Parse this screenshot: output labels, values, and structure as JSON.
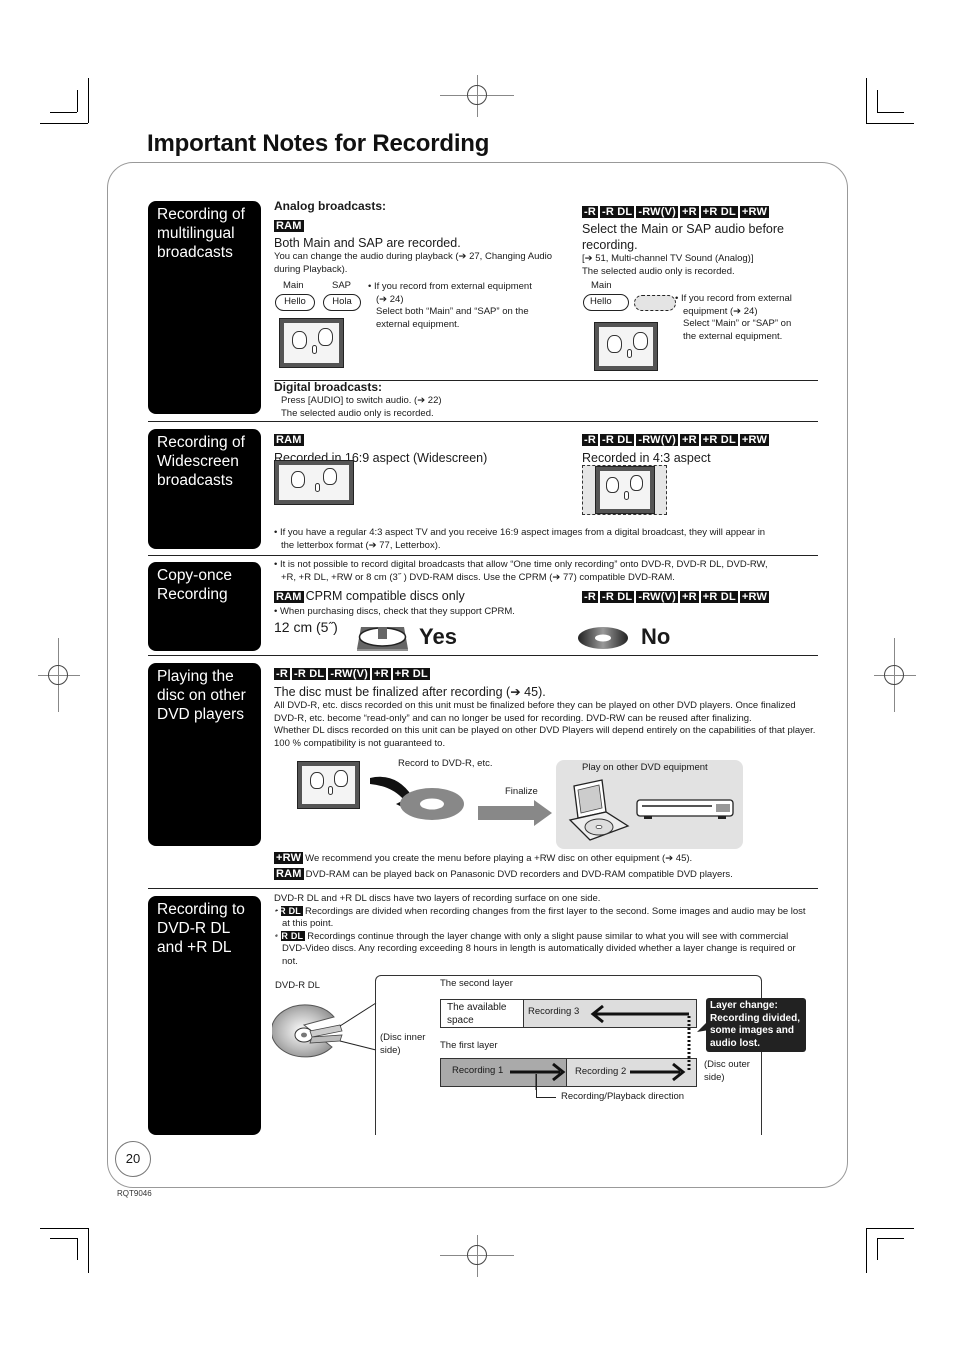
{
  "page": {
    "title": "Important Notes for Recording",
    "page_number": "20",
    "doc_code": "RQT9046"
  },
  "disc_tags": {
    "ram": "RAM",
    "minus_r": "-R",
    "minus_r_dl": "-R DL",
    "minus_rw_v": "-RW(V)",
    "plus_r": "+R",
    "plus_r_dl": "+R DL",
    "plus_rw": "+RW"
  },
  "sections": {
    "multilingual": {
      "label": "Recording of multilingual broadcasts",
      "analog_heading": "Analog broadcasts:",
      "ram_line": "Both Main and SAP are recorded.",
      "ram_note": "You can change the audio during playback (➔ 27, Changing Audio during Playback).",
      "ram_bubble_labels": [
        "Main",
        "SAP"
      ],
      "ram_bubbles": [
        "Hello",
        "Hola"
      ],
      "ram_bullet_1": "• If you record from external equipment",
      "ram_bullet_2": "(➔ 24)",
      "ram_bullet_3": "Select both “Main” and “SAP” on the",
      "ram_bullet_4": "external equipment.",
      "other_line": "Select the Main or SAP audio before recording.",
      "other_note_1": "[➔ 51, Multi-channel TV Sound (Analog)]",
      "other_note_2": "The selected audio only is recorded.",
      "other_bubble_label": "Main",
      "other_bubble": "Hello",
      "other_bullet_1": "• If you record from external",
      "other_bullet_2": "equipment (➔ 24)",
      "other_bullet_3": "Select “Main” or “SAP” on",
      "other_bullet_4": "the external equipment.",
      "digital_heading": "Digital broadcasts:",
      "digital_line_1": "Press [AUDIO] to switch audio. (➔ 22)",
      "digital_line_2": "The selected audio only is recorded."
    },
    "widescreen": {
      "label": "Recording of Widescreen broadcasts",
      "ram_line": "Recorded in 16:9 aspect (Widescreen)",
      "other_line": "Recorded in 4:3 aspect",
      "note_1": "• If you have a regular 4:3 aspect TV and you receive 16:9 aspect images from a digital broadcast, they will appear in",
      "note_2": "the letterbox format (➔ 77, Letterbox)."
    },
    "copy_once": {
      "label": "Copy-once Recording",
      "note_1": "• It is not possible to record digital broadcasts that allow “One time only recording” onto DVD-R, DVD-R DL, DVD-RW,",
      "note_2": "+R, +R DL, +RW or 8 cm (3˝ ) DVD-RAM discs. Use the CPRM (➔ 77) compatible DVD-RAM.",
      "ram_line": "CPRM compatible discs only",
      "ram_note": "• When purchasing discs, check that they support CPRM.",
      "size_label": "12 cm (5˝)",
      "yes_label": "Yes",
      "no_label": "No"
    },
    "other_players": {
      "label": "Playing the disc on other DVD players",
      "headline": "The disc must be finalized after recording (➔ 45).",
      "body_1": "All DVD-R, etc. discs recorded on this unit must be finalized before they can be played on other DVD players. Once finalized DVD-R, etc. become “read-only” and can no longer be used for recording. DVD-RW can be reused after finalizing.",
      "body_2": "Whether DL discs recorded on this unit can be played on other DVD Players will depend entirely on the capabilities of that player. 100 % compatibility is not guaranteed to.",
      "record_label": "Record to DVD-R, etc.",
      "finalize_label": "Finalize",
      "play_label": "Play on other DVD equipment",
      "plus_rw_note": "We recommend you create the menu before playing a +RW disc on other equipment (➔ 45).",
      "ram_note": "DVD-RAM can be played back on Panasonic DVD recorders and DVD-RAM compatible DVD players."
    },
    "dual_layer": {
      "label": "Recording to DVD-R DL and +R DL",
      "intro": "DVD-R DL and +R DL discs have two layers of recording surface on one side.",
      "minus_note": "Recordings are divided when recording changes from the first layer to the second. Some images and audio may be lost at this point.",
      "plus_note": "Recordings continue through the layer change with only a slight pause similar to what you will see with commercial DVD-Video discs. Any recording exceeding 8 hours in length is automatically divided whether a layer change is required or not.",
      "disc_label": "DVD-R DL",
      "second_layer": "The second layer",
      "first_layer": "The first layer",
      "available_space": "The available space",
      "recording_1": "Recording 1",
      "recording_2": "Recording 2",
      "recording_3": "Recording 3",
      "inner_side": "(Disc inner side)",
      "outer_side": "(Disc outer side)",
      "direction": "Recording/Playback direction",
      "callout": "Layer change: Recording divided, some images and audio lost."
    }
  }
}
